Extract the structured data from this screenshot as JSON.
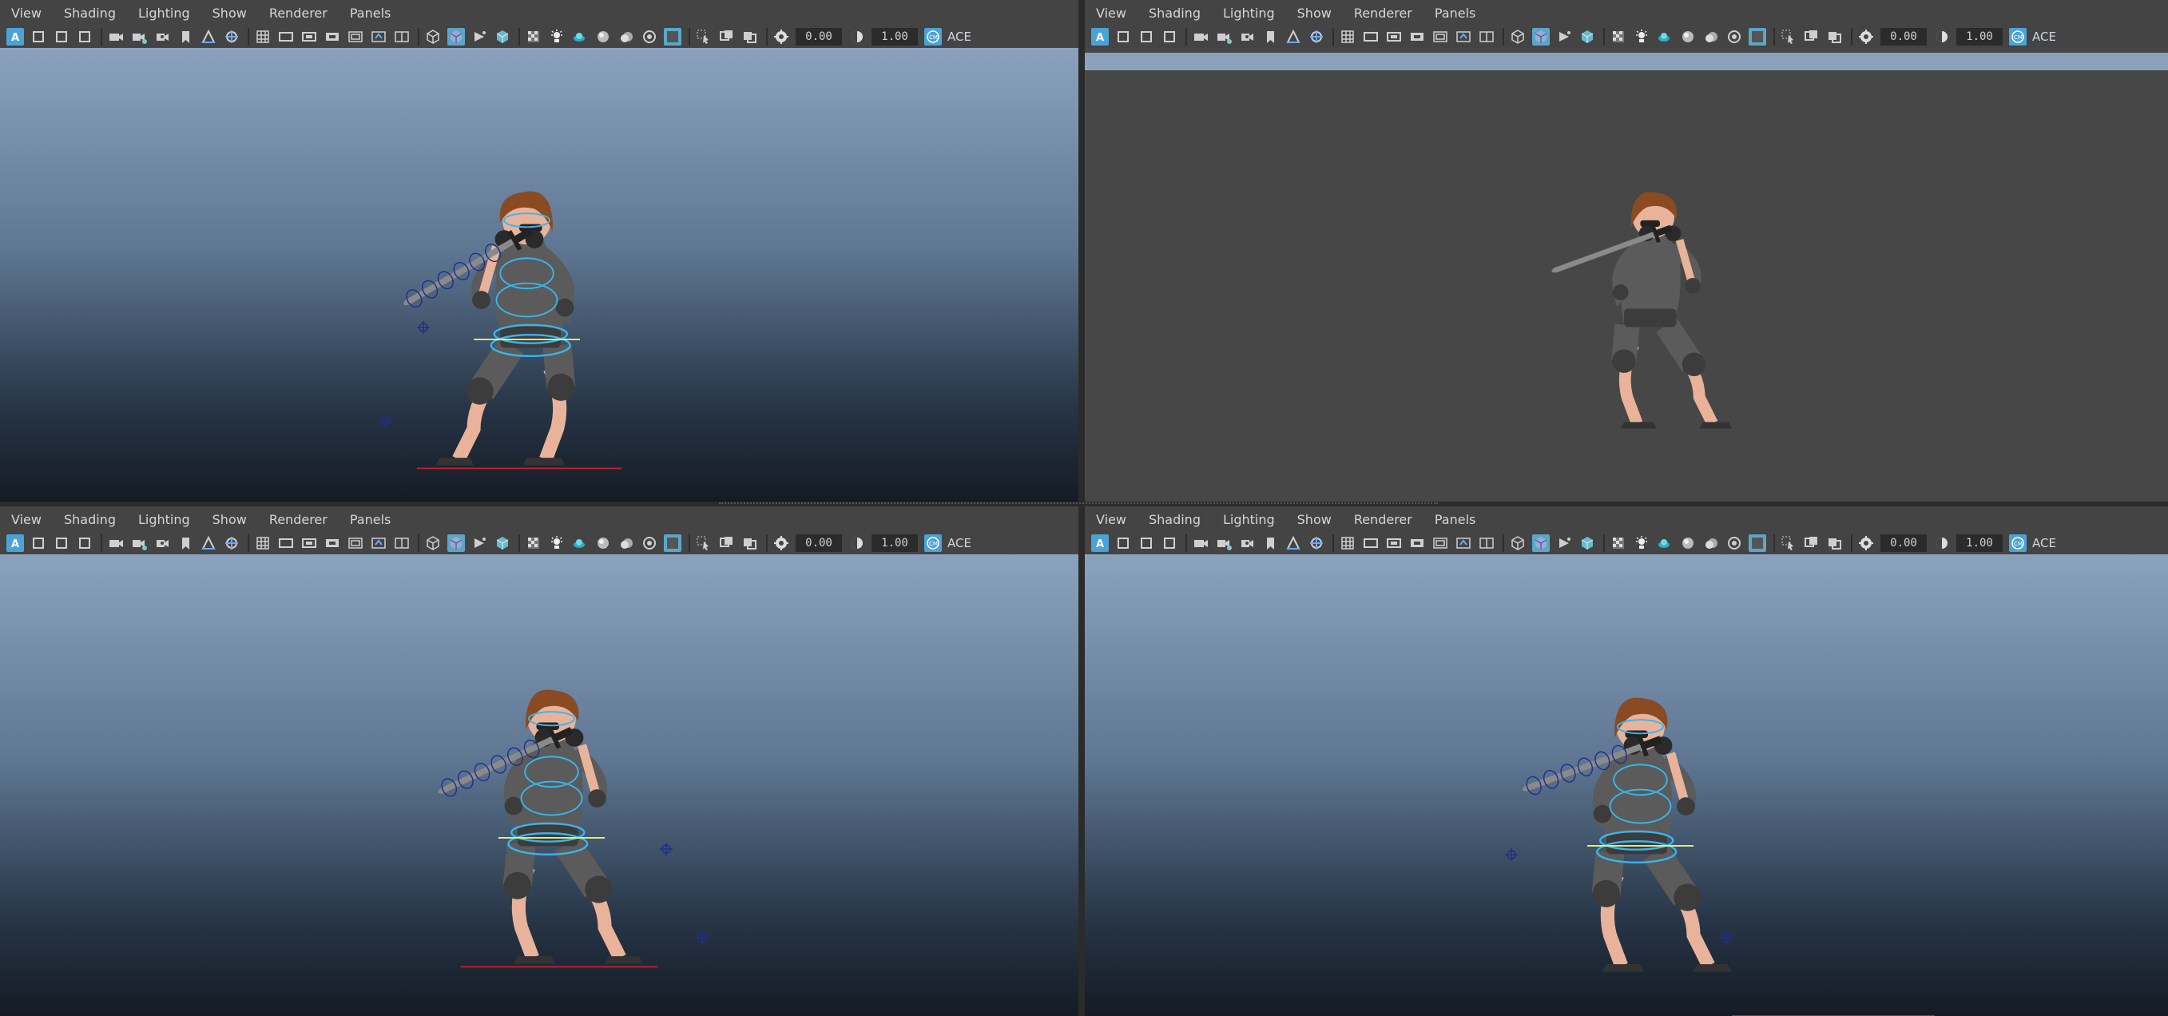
{
  "menus": [
    "View",
    "Shading",
    "Lighting",
    "Show",
    "Renderer",
    "Panels"
  ],
  "exposure_value": "0.00",
  "gamma_value": "1.00",
  "colorspace_label": "ACE",
  "panels": [
    {
      "name": "perspective-panel-top-left",
      "menus": [
        "View",
        "Shading",
        "Lighting",
        "Show",
        "Renderer",
        "Panels"
      ],
      "exposure": "0.00",
      "gamma": "1.00",
      "aces": "ACE"
    },
    {
      "name": "perspective-panel-top-right",
      "menus": [
        "View",
        "Shading",
        "Lighting",
        "Show",
        "Renderer",
        "Panels"
      ],
      "exposure": "0.00",
      "gamma": "1.00",
      "aces": "ACE"
    },
    {
      "name": "perspective-panel-bottom-left",
      "menus": [
        "View",
        "Shading",
        "Lighting",
        "Show",
        "Renderer",
        "Panels"
      ],
      "exposure": "0.00",
      "gamma": "1.00",
      "aces": "ACE"
    },
    {
      "name": "perspective-panel-bottom-right",
      "menus": [
        "View",
        "Shading",
        "Lighting",
        "Show",
        "Renderer",
        "Panels"
      ],
      "exposure": "0.00",
      "gamma": "1.00",
      "aces": "ACE"
    }
  ],
  "colors": {
    "panel_bg": "#444444",
    "viewport_gradient_top": "#8aa2bd",
    "viewport_gradient_bottom": "#141b24",
    "viewport_gray": "#474747",
    "accent_active": "#5aa7c8",
    "rig_control": "#37b6ef",
    "ground_line": "#c0202a",
    "hips_line": "#e8f07a"
  },
  "icons": {
    "toolbar": [
      "select-camera-icon",
      "camera-attributes-icon",
      "bookmark-icon",
      "image-plane-icon",
      "2d-pan-zoom-icon",
      "grease-pencil-icon",
      "grid-icon",
      "film-gate-icon",
      "resolution-gate-icon",
      "gate-mask-icon",
      "field-chart-icon",
      "safe-action-icon",
      "safe-title-icon",
      "wireframe-icon",
      "smooth-shade-icon",
      "wireframe-on-shaded-icon",
      "textured-icon",
      "use-all-lights-icon",
      "shadows-icon",
      "screen-space-ao-icon",
      "motion-blur-icon",
      "multisample-aa-icon",
      "depth-of-field-icon",
      "isolate-select-icon",
      "xray-icon",
      "xray-joints-icon",
      "xray-active-components-icon",
      "exposure-icon",
      "gamma-icon",
      "color-management-icon"
    ]
  }
}
